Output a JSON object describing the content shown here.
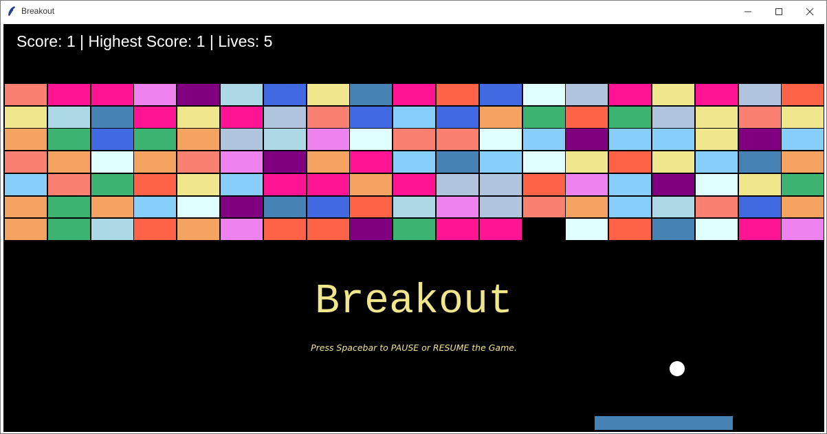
{
  "window": {
    "title": "Breakout",
    "icon": "feather-icon",
    "controls": [
      "minimize-icon",
      "maximize-icon",
      "close-icon"
    ]
  },
  "hud": {
    "text": "Score: 1 | Highest Score: 1 | Lives: 5"
  },
  "game": {
    "title": "Breakout",
    "instructions": "Press Spacebar to PAUSE or RESUME the Game.",
    "title_color": "#f0e68c",
    "background": "#000000",
    "ball_color": "#ffffff",
    "paddle_color": "#4682b4"
  },
  "bricks": {
    "rows": [
      [
        "#fa8072",
        "#ff1493",
        "#ff1493",
        "#ee82ee",
        "#800080",
        "#add8e6",
        "#4169e1",
        "#f0e68c",
        "#4682b4",
        "#ff1493",
        "#ff6347",
        "#4169e1",
        "#e0ffff",
        "#b0c4de",
        "#ff1493",
        "#f0e68c",
        "#ff1493",
        "#b0c4de",
        "#ff6347"
      ],
      [
        "#f0e68c",
        "#add8e6",
        "#4682b4",
        "#ff1493",
        "#f0e68c",
        "#ff1493",
        "#b0c4de",
        "#fa8072",
        "#4169e1",
        "#87cefa",
        "#4169e1",
        "#f4a460",
        "#3cb371",
        "#ff6347",
        "#3cb371",
        "#b0c4de",
        "#f0e68c",
        "#fa8072",
        "#f0e68c"
      ],
      [
        "#f4a460",
        "#3cb371",
        "#4169e1",
        "#3cb371",
        "#f4a460",
        "#b0c4de",
        "#add8e6",
        "#ee82ee",
        "#e0ffff",
        "#fa8072",
        "#fa8072",
        "#e0ffff",
        "#87cefa",
        "#800080",
        "#87cefa",
        "#87cefa",
        "#f0e68c",
        "#800080",
        "#87cefa"
      ],
      [
        "#fa8072",
        "#f4a460",
        "#e0ffff",
        "#f4a460",
        "#fa8072",
        "#ee82ee",
        "#800080",
        "#f4a460",
        "#ff1493",
        "#87cefa",
        "#4682b4",
        "#87cefa",
        "#e0ffff",
        "#f0e68c",
        "#ff6347",
        "#f0e68c",
        "#87cefa",
        "#4682b4",
        "#f4a460"
      ],
      [
        "#87cefa",
        "#fa8072",
        "#3cb371",
        "#ff6347",
        "#f0e68c",
        "#87cefa",
        "#ff1493",
        "#ff1493",
        "#f4a460",
        "#ff1493",
        "#b0c4de",
        "#b0c4de",
        "#ff6347",
        "#ee82ee",
        "#87cefa",
        "#800080",
        "#e0ffff",
        "#f0e68c",
        "#3cb371"
      ],
      [
        "#f4a460",
        "#3cb371",
        "#f4a460",
        "#87cefa",
        "#e0ffff",
        "#800080",
        "#4682b4",
        "#4169e1",
        "#ff6347",
        "#add8e6",
        "#ee82ee",
        "#b0c4de",
        "#fa8072",
        "#f4a460",
        "#87cefa",
        "#add8e6",
        "#fa8072",
        "#4169e1",
        "#f4a460"
      ],
      [
        "#f4a460",
        "#3cb371",
        "#add8e6",
        "#ff6347",
        "#f4a460",
        "#ee82ee",
        "#ff6347",
        "#ff6347",
        "#800080",
        "#3cb371",
        "#ff1493",
        "#ff1493",
        null,
        "#e0ffff",
        "#ff6347",
        "#4682b4",
        "#e0ffff",
        "#ff1493",
        "#ee82ee"
      ]
    ]
  }
}
